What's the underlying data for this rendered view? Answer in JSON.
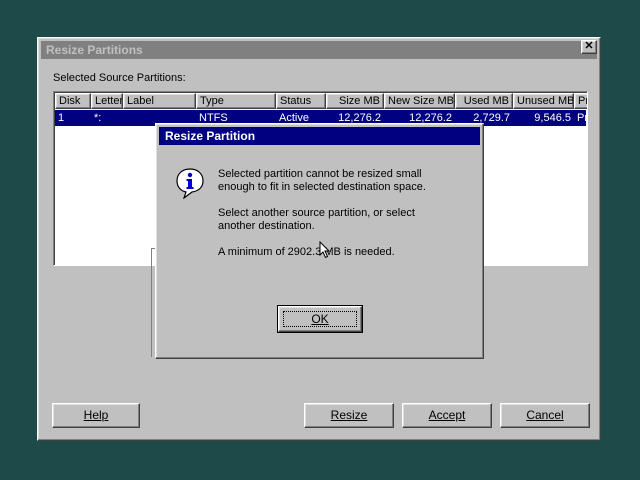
{
  "main_window": {
    "title": "Resize Partitions",
    "close_glyph": "✕",
    "source_label": "Selected Source Partitions:",
    "columns": [
      "Disk",
      "Letter",
      "Label",
      "Type",
      "Status",
      "Size MB",
      "New Size MB",
      "Used MB",
      "Unused MB",
      "Pr"
    ],
    "rows": [
      {
        "disk": "1",
        "letter": "*:",
        "label": "",
        "type": "NTFS",
        "status": "Active",
        "size": "12,276.2",
        "new_size": "12,276.2",
        "used": "2,729.7",
        "unused": "9,546.5",
        "pr": "Pr"
      }
    ],
    "buttons": {
      "help": "Help",
      "resize": "Resize",
      "accept": "Accept",
      "cancel": "Cancel"
    }
  },
  "dialog": {
    "title": "Resize Partition",
    "icon": "info-icon",
    "line1a": "Selected partition cannot be resized small",
    "line1b": "enough to fit in selected destination space.",
    "line2a": "Select another source partition, or select",
    "line2b": "another destination.",
    "line3": "A minimum of 2902.3 MB is needed.",
    "ok": "OK"
  },
  "colors": {
    "desktop": "#1f4a4a",
    "inactive_title": "#808080",
    "active_title": "#000080",
    "selection": "#000080",
    "face": "#c0c0c0"
  }
}
